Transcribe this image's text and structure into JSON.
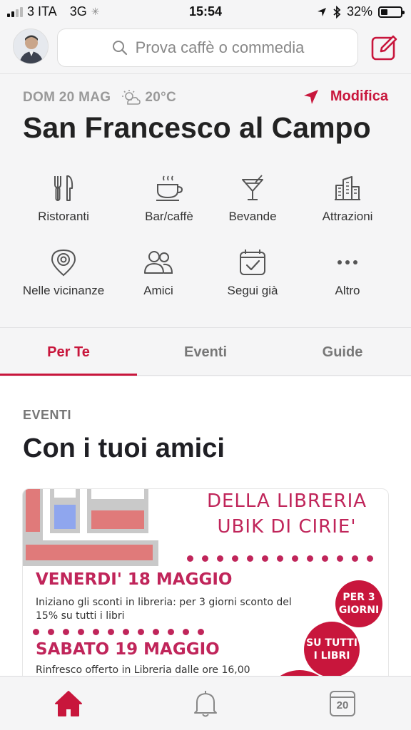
{
  "status": {
    "carrier": "3 ITA",
    "network": "3G",
    "time": "15:54",
    "battery": "32%"
  },
  "header": {
    "search_placeholder": "Prova caffè o commedia"
  },
  "location": {
    "date": "DOM 20 MAG",
    "temperature": "20°C",
    "edit_label": "Modifica",
    "city": "San Francesco al Campo"
  },
  "categories": [
    {
      "label": "Ristoranti",
      "icon": "fork-knife-icon"
    },
    {
      "label": "Bar/caffè",
      "icon": "coffee-cup-icon"
    },
    {
      "label": "Bevande",
      "icon": "cocktail-icon"
    },
    {
      "label": "Attrazioni",
      "icon": "buildings-icon"
    },
    {
      "label": "Nelle vicinanze",
      "icon": "location-pin-icon"
    },
    {
      "label": "Amici",
      "icon": "friends-icon"
    },
    {
      "label": "Segui già",
      "icon": "calendar-check-icon"
    },
    {
      "label": "Altro",
      "icon": "more-icon"
    }
  ],
  "tabs": [
    {
      "label": "Per Te",
      "active": true
    },
    {
      "label": "Eventi",
      "active": false
    },
    {
      "label": "Guide",
      "active": false
    }
  ],
  "section": {
    "kicker": "EVENTI",
    "title": "Con i tuoi amici"
  },
  "event_poster": {
    "title_line1": "DELLA LIBRERIA",
    "title_line2": "UBIK DI CIRIE'",
    "heading1": "VENERDI' 18 MAGGIO",
    "text1": "Iniziano gli sconti in libreria: per 3 giorni sconto del 15% su tutti i libri",
    "heading2": "SABATO 19 MAGGIO",
    "text2": "Rinfresco offerto in Libreria dalle ore 16,00",
    "bubble1": "PER 3 GIORNI",
    "bubble2": "SU TUTTI I LIBRI"
  },
  "bottom_nav": {
    "calendar_day": "20"
  },
  "colors": {
    "accent": "#c8163c",
    "background": "#f5f5f6"
  }
}
